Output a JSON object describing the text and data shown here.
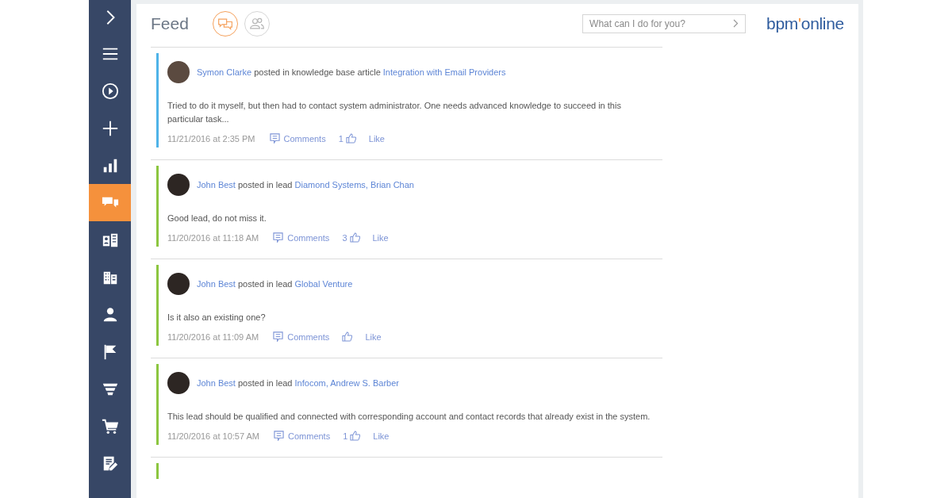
{
  "sidebar": {
    "items": [
      {
        "kind": "chevron",
        "selected": false
      },
      {
        "kind": "menu",
        "selected": false
      },
      {
        "kind": "play",
        "selected": false
      },
      {
        "kind": "plus",
        "selected": false
      },
      {
        "kind": "chart",
        "selected": false
      },
      {
        "kind": "feed",
        "selected": true
      },
      {
        "kind": "contact-card",
        "selected": false
      },
      {
        "kind": "building",
        "selected": false
      },
      {
        "kind": "person",
        "selected": false
      },
      {
        "kind": "flag",
        "selected": false
      },
      {
        "kind": "funnel",
        "selected": false
      },
      {
        "kind": "cart",
        "selected": false
      },
      {
        "kind": "document",
        "selected": false
      }
    ]
  },
  "header": {
    "title": "Feed",
    "view_tabs": [
      {
        "kind": "chat",
        "selected": true
      },
      {
        "kind": "people",
        "selected": false
      }
    ],
    "search": {
      "placeholder": "What can I do for you?"
    },
    "logo": {
      "left": "bpm",
      "mark": "'",
      "right": "online"
    }
  },
  "posts": [
    {
      "color": "#4fb3e8",
      "author": "Symon Clarke",
      "action": "posted in knowledge base article",
      "target": "Integration with Email Providers",
      "text": "Tried to do it myself, but then had to contact system administrator. One needs advanced knowledge to succeed in this particular task...",
      "date": "11/21/2016 at 2:35 PM",
      "comments": "Comments",
      "likes": "1",
      "like": "Like"
    },
    {
      "color": "#8cc63f",
      "author": "John Best",
      "action": "posted in lead",
      "target": "Diamond Systems, Brian Chan",
      "text": "Good lead, do not miss it.",
      "date": "11/20/2016 at 11:18 AM",
      "comments": "Comments",
      "likes": "3",
      "like": "Like"
    },
    {
      "color": "#8cc63f",
      "author": "John Best",
      "action": "posted in lead",
      "target": "Global Venture",
      "text": "Is it also an existing one?",
      "date": "11/20/2016 at 11:09 AM",
      "comments": "Comments",
      "like": "Like"
    },
    {
      "color": "#8cc63f",
      "author": "John Best",
      "action": "posted in lead",
      "target": "Infocom, Andrew S. Barber",
      "text": "This lead should be qualified and connected with corresponding account and contact records that already exist in the system.",
      "date": "11/20/2016 at 10:57 AM",
      "comments": "Comments",
      "likes": "1",
      "like": "Like"
    }
  ],
  "next_post": {
    "color": "#8cc63f"
  }
}
